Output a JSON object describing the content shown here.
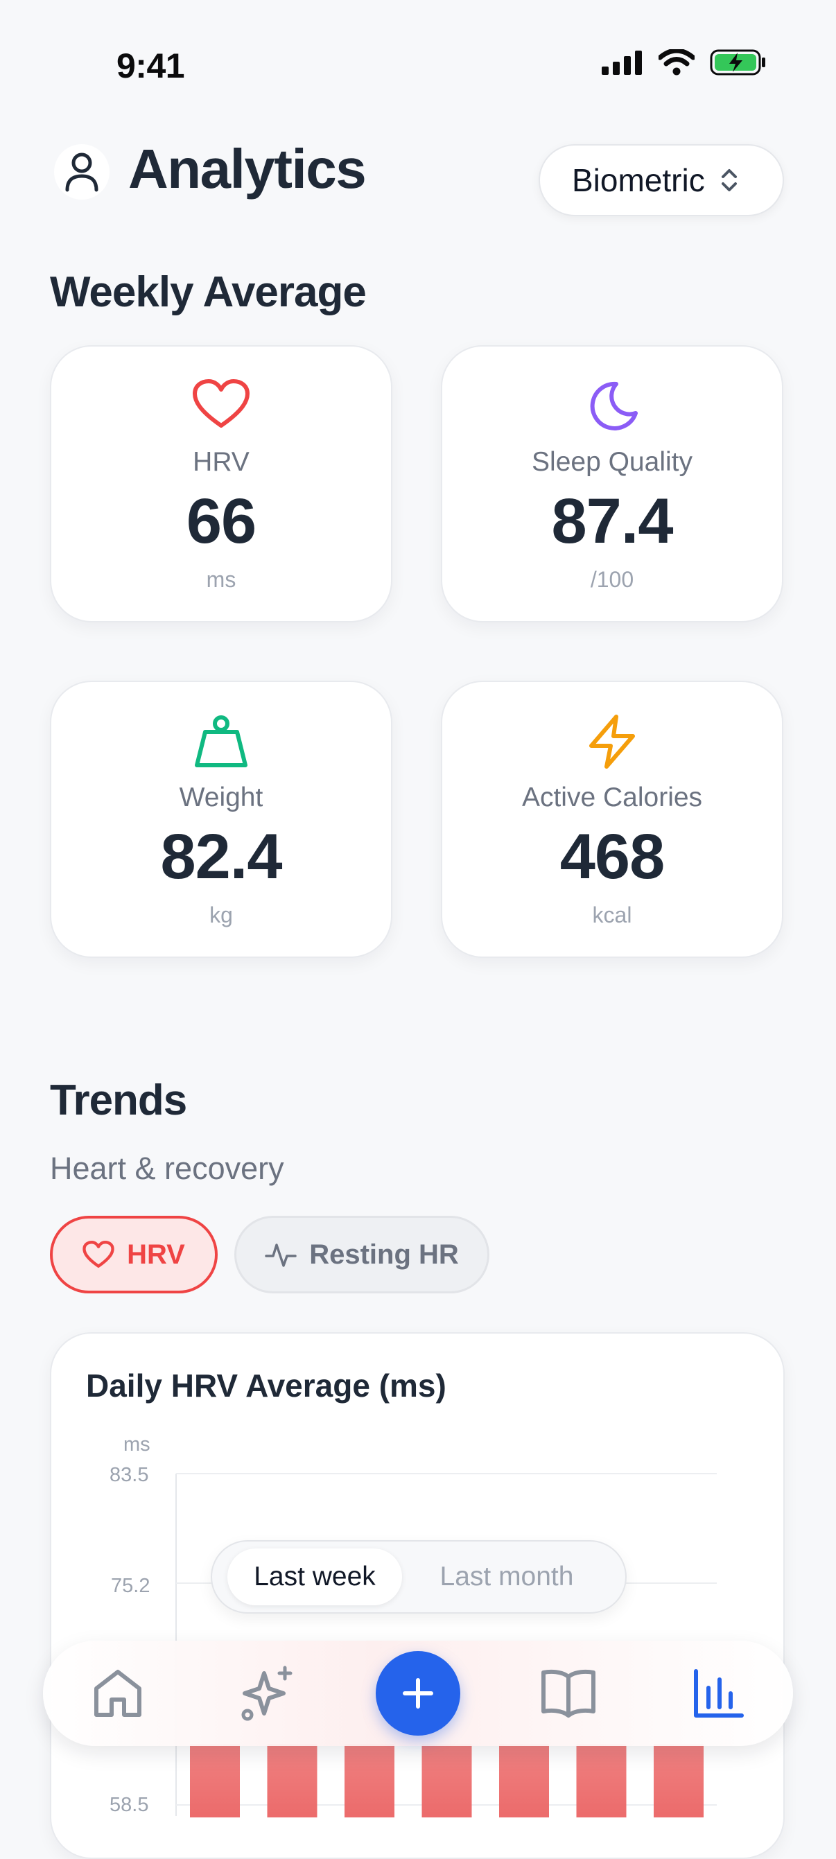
{
  "status_bar": {
    "time": "9:41"
  },
  "header": {
    "title": "Analytics",
    "selector_value": "Biometric"
  },
  "weekly": {
    "title": "Weekly Average",
    "cards": [
      {
        "label": "HRV",
        "value": "66",
        "unit": "ms",
        "icon": "heart-icon",
        "color": "#ef4444"
      },
      {
        "label": "Sleep Quality",
        "value": "87.4",
        "unit": "/100",
        "icon": "moon-icon",
        "color": "#8b5cf6"
      },
      {
        "label": "Weight",
        "value": "82.4",
        "unit": "kg",
        "icon": "weight-icon",
        "color": "#10b981"
      },
      {
        "label": "Active Calories",
        "value": "468",
        "unit": "kcal",
        "icon": "lightning-icon",
        "color": "#f59e0b"
      }
    ]
  },
  "trends": {
    "title": "Trends",
    "subtitle": "Heart & recovery",
    "chips": [
      {
        "label": "HRV",
        "selected": true
      },
      {
        "label": "Resting HR",
        "selected": false
      }
    ]
  },
  "chart": {
    "title": "Daily HRV Average (ms)",
    "unit_label": "ms",
    "range_options": [
      "Last week",
      "Last month"
    ],
    "range_selected": "Last week"
  },
  "chart_data": {
    "type": "bar",
    "title": "Daily HRV Average (ms)",
    "ylabel": "ms",
    "y_ticks": [
      83.5,
      75.2,
      58.5
    ],
    "bar_count": 7,
    "bar_color": "#ec6b6b",
    "grid": true
  },
  "colors": {
    "accent": "#2563eb",
    "hrv": "#ef4444"
  },
  "bottom_nav": {
    "items": [
      "home-icon",
      "sparkle-icon",
      "add-icon",
      "book-icon",
      "chart-icon"
    ],
    "active": "chart-icon"
  }
}
